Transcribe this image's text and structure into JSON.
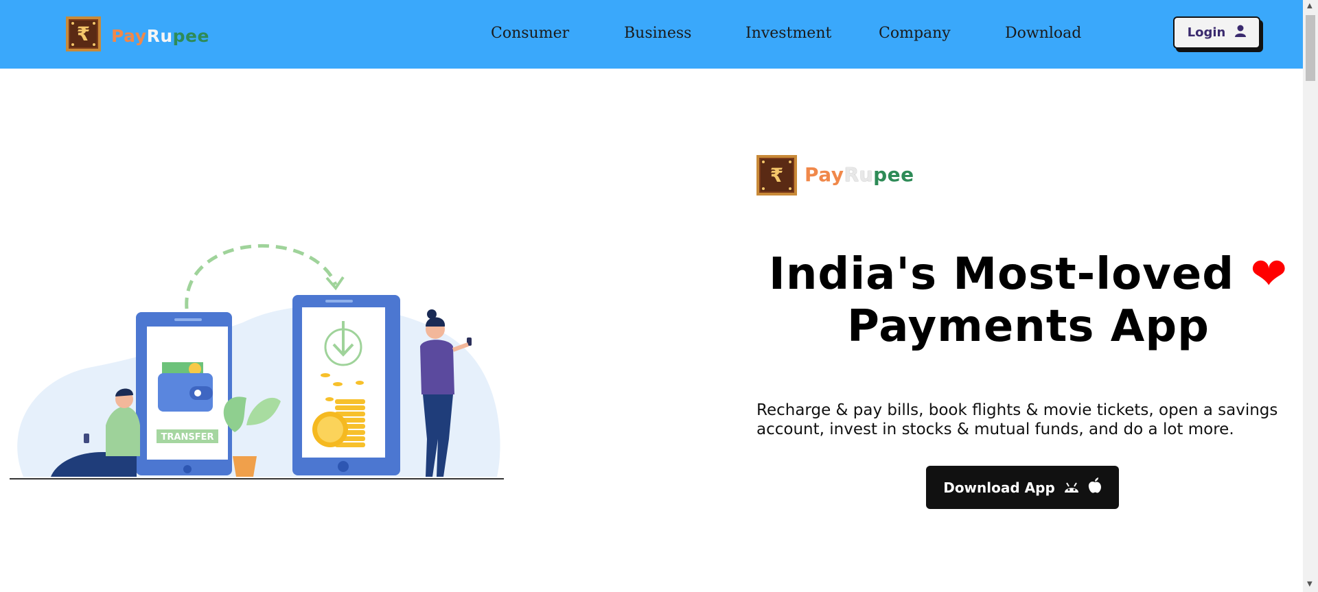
{
  "header": {
    "brand": {
      "part1": "Pay",
      "part2": "Ru",
      "part3": "pee"
    },
    "nav": [
      "Consumer",
      "Business",
      "Investment",
      "Company",
      "Download"
    ],
    "login_label": "Login"
  },
  "hero": {
    "brand": {
      "part1": "Pay",
      "part2": "Ru",
      "part3": "pee"
    },
    "title_line1": "India's Most-loved",
    "heart": "❤",
    "title_line2": "Payments App",
    "description": "Recharge & pay bills, book flights & movie tickets, open a savings account, invest in stocks & mutual funds, and do a lot more.",
    "download_label": "Download App",
    "illustration_label": "TRANSFER"
  },
  "icons": {
    "logo": "rupee-frame-icon",
    "login": "user-icon",
    "android": "android-icon",
    "apple": "apple-icon"
  },
  "colors": {
    "header_bg": "#3aa8fb",
    "button_dark": "#111111",
    "heart": "#ff0000",
    "brand_orange": "#f0884a",
    "brand_green": "#2e8b57"
  }
}
